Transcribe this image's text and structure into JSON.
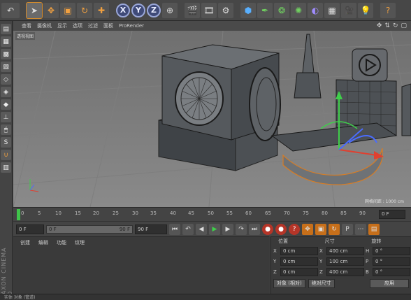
{
  "toolbar": {
    "icons": [
      "undo-icon",
      "pointer-icon",
      "move-icon",
      "scale-icon",
      "rotate-icon",
      "add-icon",
      "x-axis",
      "y-axis",
      "z-axis",
      "world-coords-icon",
      "render-view-icon",
      "render-icon",
      "render-settings-icon",
      "cube-icon",
      "pen-icon",
      "subdivision-icon",
      "array-icon",
      "deformer-icon",
      "floor-icon",
      "camera-icon",
      "light-icon",
      "help-icon"
    ],
    "axes": [
      "X",
      "Y",
      "Z"
    ]
  },
  "viewport": {
    "menu": [
      "查看",
      "摄像机",
      "显示",
      "选项",
      "过滤",
      "面板",
      "ProRender"
    ],
    "label": "透视视图",
    "grid_info": "网格间距 : 1000 cm"
  },
  "timeline": {
    "ticks": [
      "0",
      "5",
      "10",
      "15",
      "20",
      "25",
      "30",
      "35",
      "40",
      "45",
      "50",
      "55",
      "60",
      "65",
      "70",
      "75",
      "80",
      "85",
      "90"
    ],
    "current_frame": "0 F",
    "start_field": "0 F",
    "range_start": "0 F",
    "range_end": "90 F",
    "end_field": "90 F"
  },
  "materials": {
    "menu": [
      "创建",
      "编辑",
      "功能",
      "纹理"
    ]
  },
  "coordinates": {
    "headers": [
      "位置",
      "尺寸",
      "旋转"
    ],
    "rows": [
      {
        "axis": "X",
        "pos": "0 cm",
        "size_axis": "X",
        "size": "400 cm",
        "rot_axis": "H",
        "rot": "0 °"
      },
      {
        "axis": "Y",
        "pos": "0 cm",
        "size_axis": "Y",
        "size": "100 cm",
        "rot_axis": "P",
        "rot": "0 °"
      },
      {
        "axis": "Z",
        "pos": "0 cm",
        "size_axis": "Z",
        "size": "400 cm",
        "rot_axis": "B",
        "rot": "0 °"
      }
    ],
    "mode_dropdown": "对象 (相对)",
    "size_dropdown": "绝对尺寸",
    "apply_label": "应用"
  },
  "status_text": "实体 对象 (管道)",
  "side_logo": "MAXON CINEMA 4D"
}
